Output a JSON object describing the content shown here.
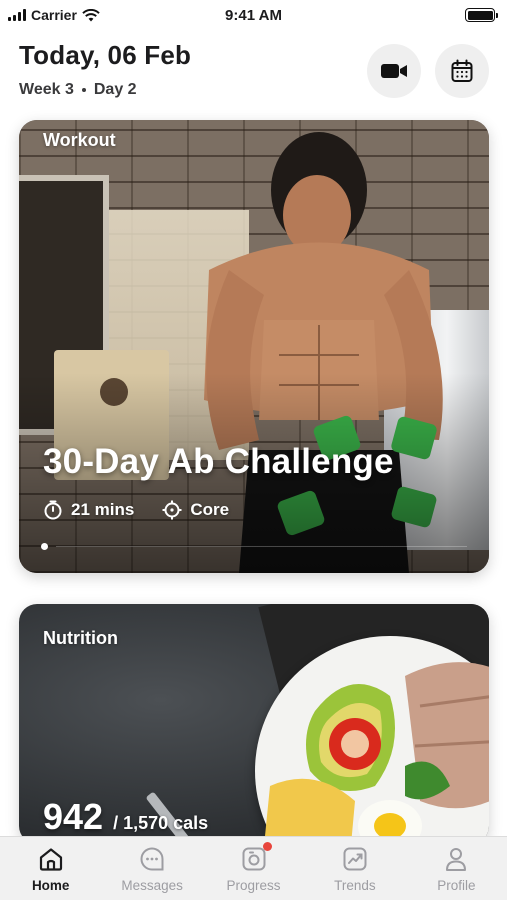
{
  "status_bar": {
    "carrier": "Carrier",
    "time": "9:41 AM"
  },
  "header": {
    "title": "Today, 06 Feb",
    "week": "Week 3",
    "day": "Day 2",
    "actions": [
      {
        "icon": "video-camera-icon"
      },
      {
        "icon": "calendar-icon"
      }
    ]
  },
  "workout": {
    "label": "Workout",
    "title": "30-Day Ab Challenge",
    "duration": "21 mins",
    "focus": "Core",
    "carousel_index": 1
  },
  "nutrition": {
    "label": "Nutrition",
    "value": "942",
    "total": "/ 1,570 cals"
  },
  "tab_bar": {
    "items": [
      {
        "label": "Home",
        "icon": "home-icon",
        "active": true
      },
      {
        "label": "Messages",
        "icon": "chat-icon"
      },
      {
        "label": "Progress",
        "icon": "camera-progress-icon",
        "badge": true
      },
      {
        "label": "Trends",
        "icon": "trend-chart-icon"
      },
      {
        "label": "Profile",
        "icon": "user-icon"
      }
    ]
  },
  "colors": {
    "badge": "#e8453c",
    "active_tab": "#1c1c1e",
    "inactive_tab": "#9d9da2"
  }
}
